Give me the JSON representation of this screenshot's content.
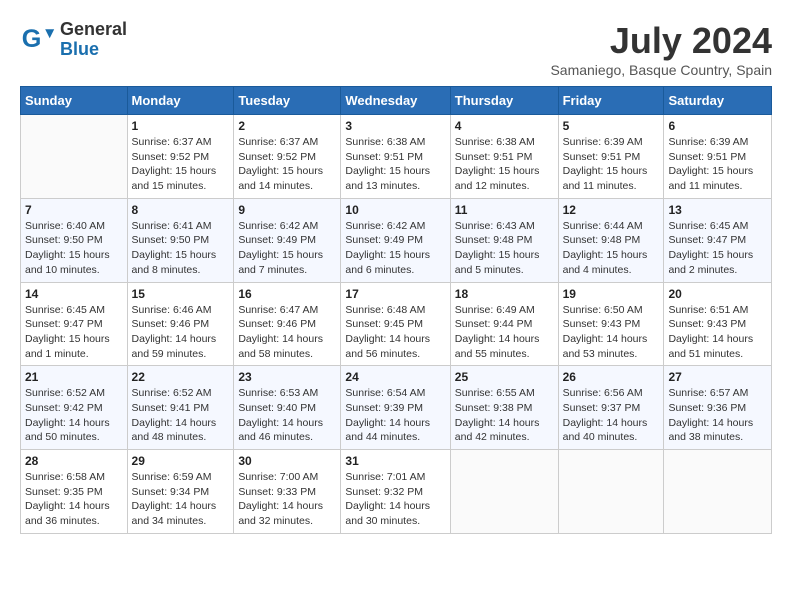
{
  "header": {
    "logo_general": "General",
    "logo_blue": "Blue",
    "month_year": "July 2024",
    "location": "Samaniego, Basque Country, Spain"
  },
  "days_of_week": [
    "Sunday",
    "Monday",
    "Tuesday",
    "Wednesday",
    "Thursday",
    "Friday",
    "Saturday"
  ],
  "weeks": [
    [
      {
        "day": "",
        "info": ""
      },
      {
        "day": "1",
        "info": "Sunrise: 6:37 AM\nSunset: 9:52 PM\nDaylight: 15 hours\nand 15 minutes."
      },
      {
        "day": "2",
        "info": "Sunrise: 6:37 AM\nSunset: 9:52 PM\nDaylight: 15 hours\nand 14 minutes."
      },
      {
        "day": "3",
        "info": "Sunrise: 6:38 AM\nSunset: 9:51 PM\nDaylight: 15 hours\nand 13 minutes."
      },
      {
        "day": "4",
        "info": "Sunrise: 6:38 AM\nSunset: 9:51 PM\nDaylight: 15 hours\nand 12 minutes."
      },
      {
        "day": "5",
        "info": "Sunrise: 6:39 AM\nSunset: 9:51 PM\nDaylight: 15 hours\nand 11 minutes."
      },
      {
        "day": "6",
        "info": "Sunrise: 6:39 AM\nSunset: 9:51 PM\nDaylight: 15 hours\nand 11 minutes."
      }
    ],
    [
      {
        "day": "7",
        "info": "Sunrise: 6:40 AM\nSunset: 9:50 PM\nDaylight: 15 hours\nand 10 minutes."
      },
      {
        "day": "8",
        "info": "Sunrise: 6:41 AM\nSunset: 9:50 PM\nDaylight: 15 hours\nand 8 minutes."
      },
      {
        "day": "9",
        "info": "Sunrise: 6:42 AM\nSunset: 9:49 PM\nDaylight: 15 hours\nand 7 minutes."
      },
      {
        "day": "10",
        "info": "Sunrise: 6:42 AM\nSunset: 9:49 PM\nDaylight: 15 hours\nand 6 minutes."
      },
      {
        "day": "11",
        "info": "Sunrise: 6:43 AM\nSunset: 9:48 PM\nDaylight: 15 hours\nand 5 minutes."
      },
      {
        "day": "12",
        "info": "Sunrise: 6:44 AM\nSunset: 9:48 PM\nDaylight: 15 hours\nand 4 minutes."
      },
      {
        "day": "13",
        "info": "Sunrise: 6:45 AM\nSunset: 9:47 PM\nDaylight: 15 hours\nand 2 minutes."
      }
    ],
    [
      {
        "day": "14",
        "info": "Sunrise: 6:45 AM\nSunset: 9:47 PM\nDaylight: 15 hours\nand 1 minute."
      },
      {
        "day": "15",
        "info": "Sunrise: 6:46 AM\nSunset: 9:46 PM\nDaylight: 14 hours\nand 59 minutes."
      },
      {
        "day": "16",
        "info": "Sunrise: 6:47 AM\nSunset: 9:46 PM\nDaylight: 14 hours\nand 58 minutes."
      },
      {
        "day": "17",
        "info": "Sunrise: 6:48 AM\nSunset: 9:45 PM\nDaylight: 14 hours\nand 56 minutes."
      },
      {
        "day": "18",
        "info": "Sunrise: 6:49 AM\nSunset: 9:44 PM\nDaylight: 14 hours\nand 55 minutes."
      },
      {
        "day": "19",
        "info": "Sunrise: 6:50 AM\nSunset: 9:43 PM\nDaylight: 14 hours\nand 53 minutes."
      },
      {
        "day": "20",
        "info": "Sunrise: 6:51 AM\nSunset: 9:43 PM\nDaylight: 14 hours\nand 51 minutes."
      }
    ],
    [
      {
        "day": "21",
        "info": "Sunrise: 6:52 AM\nSunset: 9:42 PM\nDaylight: 14 hours\nand 50 minutes."
      },
      {
        "day": "22",
        "info": "Sunrise: 6:52 AM\nSunset: 9:41 PM\nDaylight: 14 hours\nand 48 minutes."
      },
      {
        "day": "23",
        "info": "Sunrise: 6:53 AM\nSunset: 9:40 PM\nDaylight: 14 hours\nand 46 minutes."
      },
      {
        "day": "24",
        "info": "Sunrise: 6:54 AM\nSunset: 9:39 PM\nDaylight: 14 hours\nand 44 minutes."
      },
      {
        "day": "25",
        "info": "Sunrise: 6:55 AM\nSunset: 9:38 PM\nDaylight: 14 hours\nand 42 minutes."
      },
      {
        "day": "26",
        "info": "Sunrise: 6:56 AM\nSunset: 9:37 PM\nDaylight: 14 hours\nand 40 minutes."
      },
      {
        "day": "27",
        "info": "Sunrise: 6:57 AM\nSunset: 9:36 PM\nDaylight: 14 hours\nand 38 minutes."
      }
    ],
    [
      {
        "day": "28",
        "info": "Sunrise: 6:58 AM\nSunset: 9:35 PM\nDaylight: 14 hours\nand 36 minutes."
      },
      {
        "day": "29",
        "info": "Sunrise: 6:59 AM\nSunset: 9:34 PM\nDaylight: 14 hours\nand 34 minutes."
      },
      {
        "day": "30",
        "info": "Sunrise: 7:00 AM\nSunset: 9:33 PM\nDaylight: 14 hours\nand 32 minutes."
      },
      {
        "day": "31",
        "info": "Sunrise: 7:01 AM\nSunset: 9:32 PM\nDaylight: 14 hours\nand 30 minutes."
      },
      {
        "day": "",
        "info": ""
      },
      {
        "day": "",
        "info": ""
      },
      {
        "day": "",
        "info": ""
      }
    ]
  ]
}
